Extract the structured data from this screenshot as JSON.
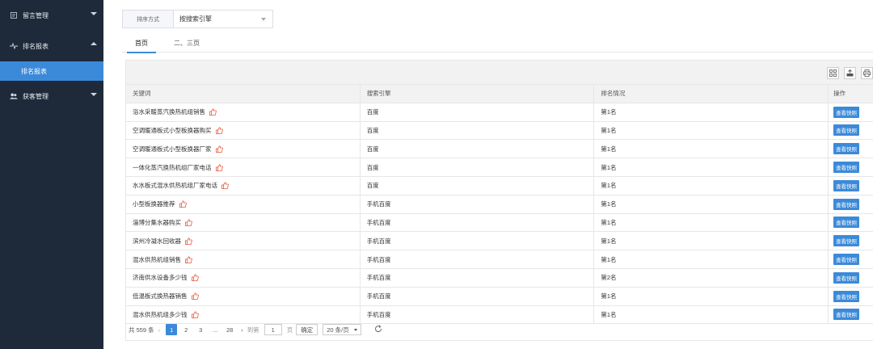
{
  "sidebar": {
    "items": [
      {
        "label": "留言管理",
        "icon": "message-icon",
        "expanded": false
      },
      {
        "label": "排名报表",
        "icon": "pulse-icon",
        "expanded": true
      },
      {
        "label": "获客管理",
        "icon": "users-icon",
        "expanded": false
      }
    ],
    "sub_items": [
      {
        "label": "排名报表"
      }
    ]
  },
  "filter": {
    "label": "排序方式",
    "value": "按搜索引擎"
  },
  "tabs": [
    {
      "label": "首页"
    },
    {
      "label": "二、三页"
    }
  ],
  "table": {
    "headers": [
      "关键词",
      "搜索引擎",
      "排名情况",
      "操作"
    ],
    "action_label": "查看快照",
    "rows": [
      {
        "keyword": "浴水采暖蒸汽换热机组销售",
        "engine": "百度",
        "rank": "第1名"
      },
      {
        "keyword": "空调暖通板式小型板换器购买",
        "engine": "百度",
        "rank": "第1名"
      },
      {
        "keyword": "空调暖通板式小型板换器厂家",
        "engine": "百度",
        "rank": "第1名"
      },
      {
        "keyword": "一体化蒸汽换热机组厂家电话",
        "engine": "百度",
        "rank": "第1名"
      },
      {
        "keyword": "水水板式混水供热机组厂家电话",
        "engine": "百度",
        "rank": "第1名"
      },
      {
        "keyword": "小型板换器推荐",
        "engine": "手机百度",
        "rank": "第1名"
      },
      {
        "keyword": "淄博分集水器购买",
        "engine": "手机百度",
        "rank": "第1名"
      },
      {
        "keyword": "滨州冷凝水回收器",
        "engine": "手机百度",
        "rank": "第1名"
      },
      {
        "keyword": "混水供热机组销售",
        "engine": "手机百度",
        "rank": "第1名"
      },
      {
        "keyword": "济南供水设备多少钱",
        "engine": "手机百度",
        "rank": "第2名"
      },
      {
        "keyword": "低温板式换热器销售",
        "engine": "手机百度",
        "rank": "第1名"
      },
      {
        "keyword": "混水供热机组多少钱",
        "engine": "手机百度",
        "rank": "第1名"
      }
    ]
  },
  "pager": {
    "total": "共 559 条",
    "pages": [
      "1",
      "2",
      "3",
      "…",
      "28"
    ],
    "current": "1",
    "goto_label": "到第",
    "goto_value": "1",
    "page_unit": "页",
    "ok_label": "确定",
    "size_label": "20 条/页"
  },
  "colors": {
    "sidebar_bg": "#1e2a3a",
    "accent": "#3b8ad9",
    "hot_icon": "#e65a3b"
  }
}
